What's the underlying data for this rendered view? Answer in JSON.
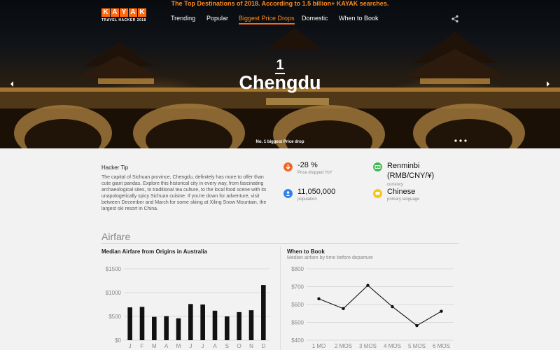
{
  "banner": "The Top Destinations of 2018. According to 1.5 billion+ KAYAK searches.",
  "logo": {
    "letters": [
      "K",
      "A",
      "Y",
      "A",
      "K"
    ],
    "sub": "TRAVEL HACKER 2018"
  },
  "nav": {
    "items": [
      {
        "label": "Trending"
      },
      {
        "label": "Popular"
      },
      {
        "label": "Biggest Price Drops",
        "active": true
      },
      {
        "label": "Domestic"
      },
      {
        "label": "When to Book"
      }
    ],
    "share_icon": "share-icon"
  },
  "hero": {
    "rank": "1",
    "city": "Chengdu",
    "caption": "No. 1 biggest Price drop",
    "prev_icon": "chevron-left-icon",
    "next_icon": "chevron-right-icon"
  },
  "tip": {
    "title": "Hacker Tip",
    "body": "The capital of Sichuan province, Chengdu, definitely has more to offer than cute giant pandas. Explore this historical city in every way, from fascinating archaeological sites, to traditional tea culture, to the local food scene with its unapologetically spicy Sichuan cuisine. If you're down for adventure, visit between December and March for some skiing at Xiling Snow Mountain, the largest ski resort in China."
  },
  "stats": [
    {
      "value": "-28 %",
      "label": "Price dropped YoY",
      "icon": "arrow-down-icon",
      "color": "#f26522"
    },
    {
      "value": "Renminbi (RMB/CNY/¥)",
      "label": "currency",
      "icon": "money-icon",
      "color": "#3fb950"
    },
    {
      "value": "11,050,000",
      "label": "population",
      "icon": "people-icon",
      "color": "#2f80ed"
    },
    {
      "value": "Chinese",
      "label": "primary language",
      "icon": "speech-icon",
      "color": "#f5c518"
    }
  ],
  "section": {
    "title": "Airfare"
  },
  "chart_data": [
    {
      "type": "bar",
      "title": "Median Airfare from Origins in Australia",
      "categories": [
        "J",
        "F",
        "M",
        "A",
        "M",
        "J",
        "J",
        "A",
        "S",
        "O",
        "N",
        "D"
      ],
      "values": [
        690,
        700,
        490,
        505,
        460,
        760,
        750,
        620,
        500,
        590,
        630,
        1160
      ],
      "ylim": [
        0,
        1500
      ],
      "yticks": [
        "$0",
        "$500",
        "$1000",
        "$1500"
      ],
      "ytick_values": [
        0,
        500,
        1000,
        1500
      ],
      "grid": true,
      "color": "#111111"
    },
    {
      "type": "line",
      "title": "When to Book",
      "subtitle": "Median airfare by time before departure",
      "categories": [
        "1 MO",
        "2 MOS",
        "3 MOS",
        "4 MOS",
        "5 MOS",
        "6 MOS"
      ],
      "values": [
        632,
        577,
        707,
        588,
        482,
        562
      ],
      "ylim": [
        400,
        800
      ],
      "yticks": [
        "$400",
        "$500",
        "$600",
        "$700",
        "$800"
      ],
      "ytick_values": [
        400,
        500,
        600,
        700,
        800
      ],
      "grid": true,
      "color": "#111111"
    }
  ]
}
